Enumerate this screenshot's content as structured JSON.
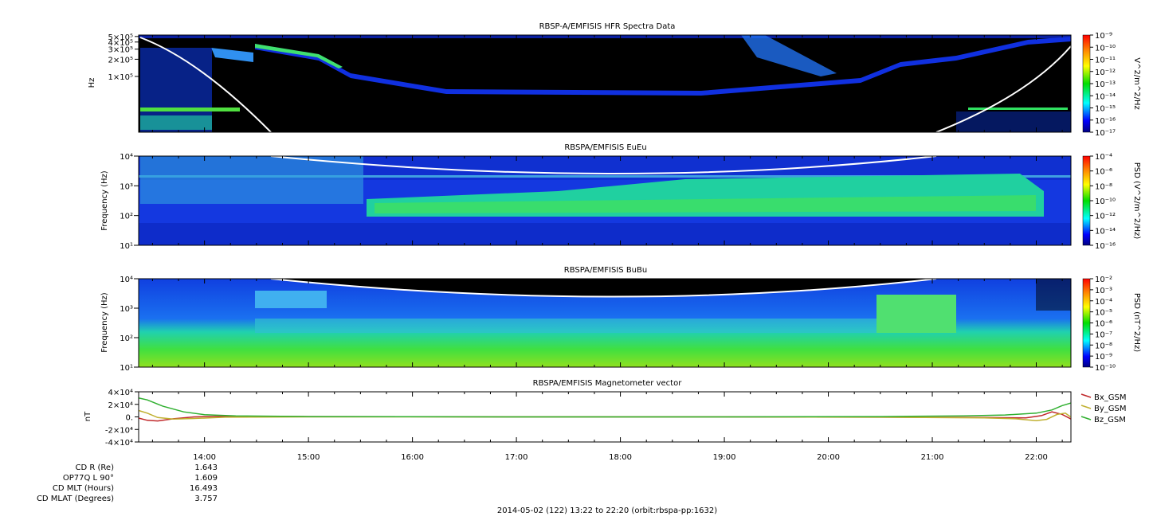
{
  "footer": "2014-05-02 (122) 13:22 to 22:20 (orbit:rbspa-pp:1632)",
  "time_ticks": [
    "14:00",
    "15:00",
    "16:00",
    "17:00",
    "18:00",
    "19:00",
    "20:00",
    "21:00",
    "22:00"
  ],
  "time_tick_hours": [
    14,
    15,
    16,
    17,
    18,
    19,
    20,
    21,
    22
  ],
  "time_range_hours": [
    13.3667,
    22.3333
  ],
  "ephemeris": {
    "labels": [
      "CD R (Re)",
      "OP77Q L 90°",
      "CD MLT (Hours)",
      "CD MLAT (Degrees)"
    ],
    "values": [
      "1.643",
      "1.609",
      "16.493",
      "3.757"
    ]
  },
  "chart_data": [
    {
      "type": "heatmap",
      "title": "RBSP-A/EMFISIS  HFR Spectra Data",
      "ylabel": "Hz",
      "ytick_labels": [
        "5×10⁵",
        "4×10⁵",
        "3×10⁵",
        "2×10⁵",
        "1×10⁵"
      ],
      "ytick_values": [
        500000,
        400000,
        300000,
        200000,
        100000
      ],
      "ylim": [
        10600,
        530000
      ],
      "colorbar": {
        "label": "V^2/m^2/Hz",
        "ticks": [
          "10⁻⁹",
          "10⁻¹⁰",
          "10⁻¹¹",
          "10⁻¹²",
          "10⁻¹³",
          "10⁻¹⁴",
          "10⁻¹⁵",
          "10⁻¹⁶",
          "10⁻¹⁷"
        ]
      }
    },
    {
      "type": "heatmap",
      "title": "RBSPA/EMFISIS  EuEu",
      "ylabel": "Frequency (Hz)",
      "ytick_labels": [
        "10⁴",
        "10³",
        "10²",
        "10¹"
      ],
      "ylim": [
        10,
        10000
      ],
      "colorbar": {
        "label": "PSD (V^2/m^2/Hz)",
        "ticks": [
          "10⁻⁴",
          "10⁻⁶",
          "10⁻⁸",
          "10⁻¹⁰",
          "10⁻¹²",
          "10⁻¹⁴",
          "10⁻¹⁶"
        ]
      }
    },
    {
      "type": "heatmap",
      "title": "RBSPA/EMFISIS  BuBu",
      "ylabel": "Frequency (Hz)",
      "ytick_labels": [
        "10⁴",
        "10³",
        "10²",
        "10¹"
      ],
      "ylim": [
        10,
        10000
      ],
      "colorbar": {
        "label": "PSD (nT^2/Hz)",
        "ticks": [
          "10⁻²",
          "10⁻³",
          "10⁻⁴",
          "10⁻⁵",
          "10⁻⁶",
          "10⁻⁷",
          "10⁻⁸",
          "10⁻⁹",
          "10⁻¹⁰"
        ]
      }
    },
    {
      "type": "line",
      "title": "RBSPA/EMFISIS  Magnetometer vector",
      "ylabel": "nT",
      "ytick_labels": [
        "4×10⁴",
        "2×10⁴",
        "0.",
        "-2×10⁴",
        "-4×10⁴"
      ],
      "ytick_values": [
        40000,
        20000,
        0,
        -20000,
        -40000
      ],
      "ylim": [
        -40000,
        40000
      ],
      "series": [
        {
          "name": "Bx_GSM",
          "color": "#c0282a",
          "x": [
            13.37,
            13.45,
            13.55,
            13.7,
            13.9,
            14.2,
            15,
            17,
            19,
            20.5,
            21.5,
            21.9,
            22.05,
            22.15,
            22.25,
            22.33
          ],
          "y": [
            -2000,
            -5500,
            -6500,
            -3000,
            0,
            1000,
            500,
            0,
            0,
            -500,
            -1000,
            -1500,
            2000,
            8000,
            4000,
            -3000
          ]
        },
        {
          "name": "By_GSM",
          "color": "#c0b030",
          "x": [
            13.37,
            13.45,
            13.55,
            13.7,
            13.9,
            14.2,
            15,
            17,
            19,
            20.5,
            21.5,
            21.8,
            22.0,
            22.1,
            22.2,
            22.28,
            22.33
          ],
          "y": [
            10000,
            6000,
            -1000,
            -3500,
            -2500,
            -500,
            0,
            0,
            0,
            -500,
            -1500,
            -3000,
            -6000,
            -4000,
            4000,
            6000,
            0
          ]
        },
        {
          "name": "Bz_GSM",
          "color": "#30b030",
          "x": [
            13.37,
            13.45,
            13.6,
            13.8,
            14.0,
            14.3,
            15,
            17,
            19,
            20.5,
            21.3,
            21.7,
            22.0,
            22.15,
            22.25,
            22.33
          ],
          "y": [
            30000,
            27000,
            17000,
            8000,
            3500,
            1500,
            500,
            0,
            0,
            500,
            1500,
            3000,
            6000,
            11000,
            18000,
            22000
          ]
        }
      ]
    }
  ]
}
